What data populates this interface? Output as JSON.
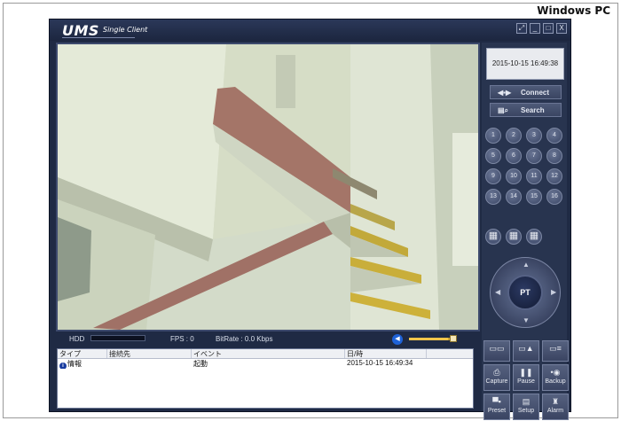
{
  "platform_label": "Windows PC",
  "app": {
    "logo": "UMS",
    "logo_subtitle": "Single Client",
    "window_controls": [
      "⤢",
      "_",
      "□",
      "X"
    ]
  },
  "status": {
    "hdd_label": "HDD",
    "hdd_usage": 0,
    "fps_text": "FPS :  0",
    "bitrate_text": "BitRate : 0.0 Kbps",
    "volume_level": 0.85
  },
  "event_log": {
    "columns": [
      "タイプ",
      "接続先",
      "イベント",
      "日/時"
    ],
    "rows": [
      {
        "type": "情報",
        "connection": "",
        "event": "起動",
        "datetime": "2015-10-15 16:49:34"
      }
    ]
  },
  "right_panel": {
    "datetime": "2015-10-15 16:49:38",
    "connect_label": "Connect",
    "search_label": "Search",
    "channels": [
      "1",
      "2",
      "3",
      "4",
      "5",
      "6",
      "7",
      "8",
      "9",
      "10",
      "11",
      "12",
      "13",
      "14",
      "15",
      "16"
    ],
    "ptz_label": "PT",
    "actions": [
      {
        "name": "view-mode-a",
        "glyph": "▭▭",
        "label": ""
      },
      {
        "name": "view-mode-b",
        "glyph": "▭▲",
        "label": ""
      },
      {
        "name": "view-mode-c",
        "glyph": "▭≡",
        "label": ""
      },
      {
        "name": "capture",
        "glyph": "⎙",
        "label": "Capture"
      },
      {
        "name": "pause",
        "glyph": "❚❚",
        "label": "Pause"
      },
      {
        "name": "backup",
        "glyph": "•◉",
        "label": "Backup"
      },
      {
        "name": "preset",
        "glyph": "▀▪",
        "label": "Preset"
      },
      {
        "name": "setup",
        "glyph": "▤",
        "label": "Setup"
      },
      {
        "name": "alarm",
        "glyph": "♜",
        "label": "Alarm"
      }
    ]
  },
  "colors": {
    "window_bg": "#1f2a44",
    "panel_bg": "#28344f",
    "accent_volume": "#f0c44a"
  }
}
